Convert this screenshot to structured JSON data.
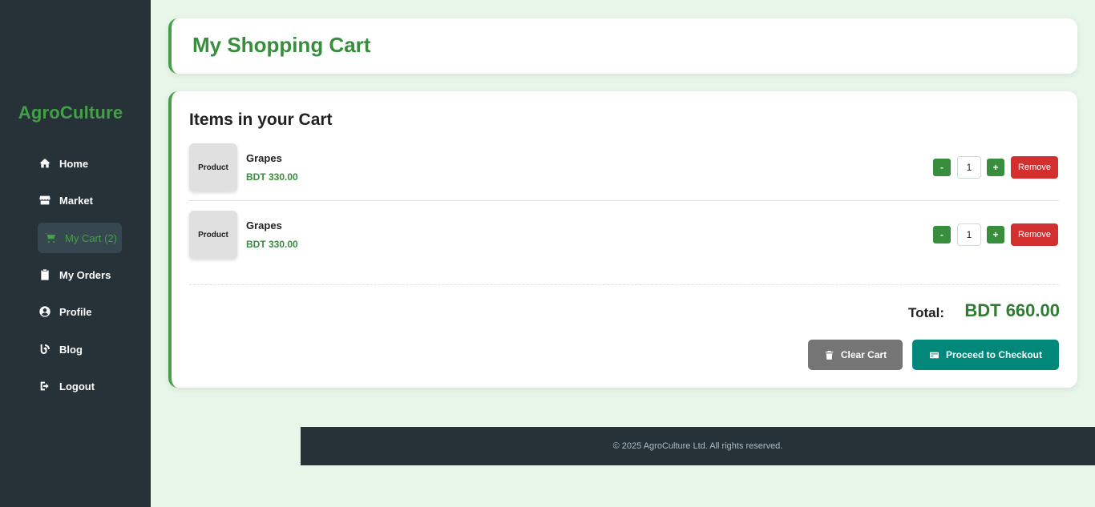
{
  "sidebar": {
    "brand": "AgroCulture",
    "items": [
      {
        "label": "Home",
        "icon": "home-icon"
      },
      {
        "label": "Market",
        "icon": "store-icon"
      },
      {
        "label": "My Cart (2)",
        "icon": "cart-icon",
        "active": true
      },
      {
        "label": "My Orders",
        "icon": "clipboard-icon"
      },
      {
        "label": "Profile",
        "icon": "user-circle-icon"
      },
      {
        "label": "Blog",
        "icon": "blog-icon"
      },
      {
        "label": "Logout",
        "icon": "logout-icon"
      }
    ]
  },
  "header": {
    "title": "My Shopping Cart"
  },
  "cart": {
    "section_title": "Items in your Cart",
    "items": [
      {
        "thumb_label": "Product",
        "name": "Grapes",
        "price": "BDT 330.00",
        "qty": "1",
        "minus": "-",
        "plus": "+",
        "remove": "Remove"
      },
      {
        "thumb_label": "Product",
        "name": "Grapes",
        "price": "BDT 330.00",
        "qty": "1",
        "minus": "-",
        "plus": "+",
        "remove": "Remove"
      }
    ],
    "total_label": "Total:",
    "total_value": "BDT 660.00",
    "clear_label": "Clear Cart",
    "checkout_label": "Proceed to Checkout"
  },
  "footer": {
    "copyright": "© 2025 AgroCulture Ltd. All rights reserved."
  },
  "colors": {
    "accent_green": "#388e3c",
    "sidebar_bg": "#263238",
    "remove_red": "#d32f2f",
    "checkout_teal": "#00897b",
    "clear_gray": "#757575",
    "page_bg": "#e8f5e9"
  }
}
